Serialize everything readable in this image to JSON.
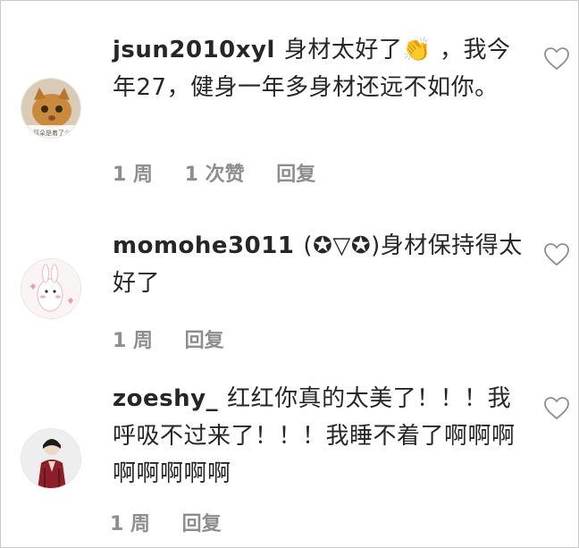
{
  "comments": [
    {
      "username": "jsun2010xyl",
      "text_line1": "身材太好了👏 ，我今",
      "text_rest": "年27，健身一年多身材还远不如你。",
      "avatar_caption": "耳朵是着了么",
      "time": "1 周",
      "likes": "1 次赞",
      "reply": "回复"
    },
    {
      "username": "momohe3011",
      "text_line1": "(✪▽✪)身材保持得太",
      "text_rest": "好了",
      "time": "1 周",
      "reply": "回复"
    },
    {
      "username": "zoeshy_",
      "text_line1": "红红你真的太美了！！！我",
      "text_rest": "呼吸不过来了！！！我睡不着了啊啊啊啊啊啊啊啊",
      "time": "1 周",
      "reply": "回复"
    }
  ],
  "colors": {
    "text": "#262626",
    "meta": "#8e8e8e",
    "heart_outline": "#8e8e8e"
  }
}
